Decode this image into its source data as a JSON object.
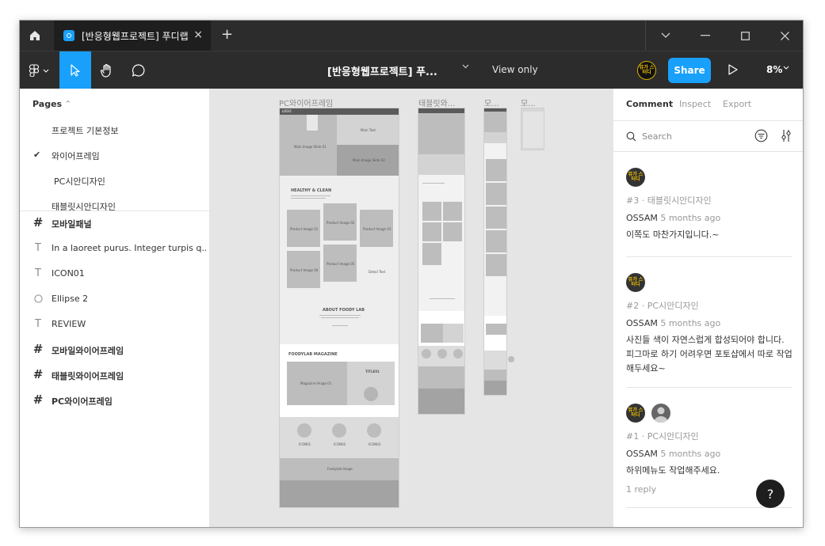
{
  "titlebar": {
    "tab_title": "[반응형웹프로젝트] 푸디랩",
    "tab_close": "×",
    "new_tab": "+"
  },
  "toolbar": {
    "file_title": "[반응형웹프로젝트] 푸...",
    "view_only": "View only",
    "share_label": "Share",
    "zoom": "8%",
    "user_avatar_text": "뮤가 스터디"
  },
  "pages": {
    "header": "Pages",
    "items": [
      "프로젝트 기본정보",
      "와이어프레임",
      "PC시안디자인",
      "태블릿시안디자인"
    ],
    "selected_mark": "✔"
  },
  "layers": [
    {
      "type": "frame",
      "name": "모바일패널"
    },
    {
      "type": "text",
      "name": "In a laoreet purus. Integer turpis q..."
    },
    {
      "type": "text",
      "name": "ICON01"
    },
    {
      "type": "ellipse",
      "name": "Ellipse 2"
    },
    {
      "type": "text",
      "name": "REVIEW"
    },
    {
      "type": "frame",
      "name": "모바일와이어프레임"
    },
    {
      "type": "frame",
      "name": "태블릿와이어프레임"
    },
    {
      "type": "frame",
      "name": "PC와이어프레임"
    }
  ],
  "canvas": {
    "frames": [
      "PC와이어프레임",
      "태블릿와...",
      "모...",
      "모..."
    ],
    "pc": {
      "logo": "LOGO",
      "hero_main": "Main Image Slide 01",
      "hero_text": "Main Text",
      "hero_sub": "Main Image Slide 02",
      "section1": "HEALTHY & CLEAN",
      "products": [
        "Product Image 01",
        "Product Image 02",
        "Product Image 03",
        "Product Image 04",
        "Product Image 05"
      ],
      "more": "Detail Text",
      "about": "ABOUT FOODY LAB",
      "magazine": "FOODYLAB MAGAZINE",
      "magazine_img": "Magazine Image 01",
      "magazine_title": "TITLE01",
      "icons": [
        "ICON01",
        "ICON02",
        "ICON03"
      ],
      "foot_img": "Foodylab Image"
    }
  },
  "rightpanel": {
    "tabs": [
      "Comment",
      "Inspect",
      "Export"
    ],
    "search_placeholder": "Search",
    "comments": [
      {
        "avatar": "뮤가 스터디",
        "page": "#3 · 태블릿시안디자인",
        "author": "OSSAM",
        "time": "5 months ago",
        "text": "이쪽도 마찬가지입니다.~"
      },
      {
        "avatar": "뮤가 스터디",
        "page": "#2 · PC시안디자인",
        "author": "OSSAM",
        "time": "5 months ago",
        "text": "사진들 색이 자연스럽게 합성되어야 합니다. 피그마로 하기 어려우면 포토샵에서 따로 작업해두세요~"
      },
      {
        "avatar": "뮤가 스터디",
        "page": "#1 · PC시안디자인",
        "author": "OSSAM",
        "time": "5 months ago",
        "text": "하위메뉴도 작업해주세요."
      }
    ],
    "reply": "1 reply",
    "help": "?"
  }
}
